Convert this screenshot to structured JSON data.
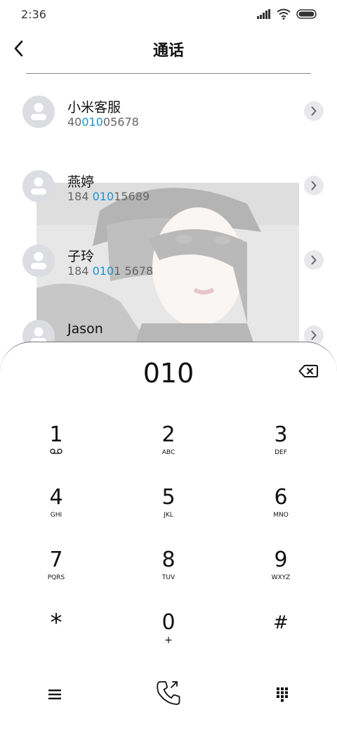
{
  "status_bar": {
    "time": "2:36"
  },
  "header": {
    "title": "通话"
  },
  "contacts": [
    {
      "name": "小米客服",
      "number_parts": [
        "40",
        "010",
        "05678"
      ]
    },
    {
      "name": "燕婷",
      "number_parts": [
        "184 ",
        "010",
        "15689"
      ]
    },
    {
      "name": "子玲",
      "number_parts": [
        "184 ",
        "010",
        "1 5678"
      ]
    },
    {
      "name": "Jason",
      "number_parts": [
        "",
        "",
        ""
      ]
    }
  ],
  "dialer": {
    "input": "010",
    "keys": [
      {
        "digit": "1",
        "letters": ""
      },
      {
        "digit": "2",
        "letters": "ABC"
      },
      {
        "digit": "3",
        "letters": "DEF"
      },
      {
        "digit": "4",
        "letters": "GHI"
      },
      {
        "digit": "5",
        "letters": "JKL"
      },
      {
        "digit": "6",
        "letters": "MNO"
      },
      {
        "digit": "7",
        "letters": "PQRS"
      },
      {
        "digit": "8",
        "letters": "TUV"
      },
      {
        "digit": "9",
        "letters": "WXYZ"
      },
      {
        "digit": "*",
        "letters": ""
      },
      {
        "digit": "0",
        "letters": "+"
      },
      {
        "digit": "#",
        "letters": ""
      }
    ]
  },
  "icons": {
    "back": "chevron-left-icon",
    "detail": "chevron-right-icon",
    "backspace": "backspace-icon",
    "voicemail": "voicemail-icon",
    "menu": "menu-icon",
    "call": "phone-icon",
    "keypad": "keypad-icon"
  },
  "colors": {
    "highlight": "#1a93d2",
    "avatar_bg": "#dcdde1"
  }
}
